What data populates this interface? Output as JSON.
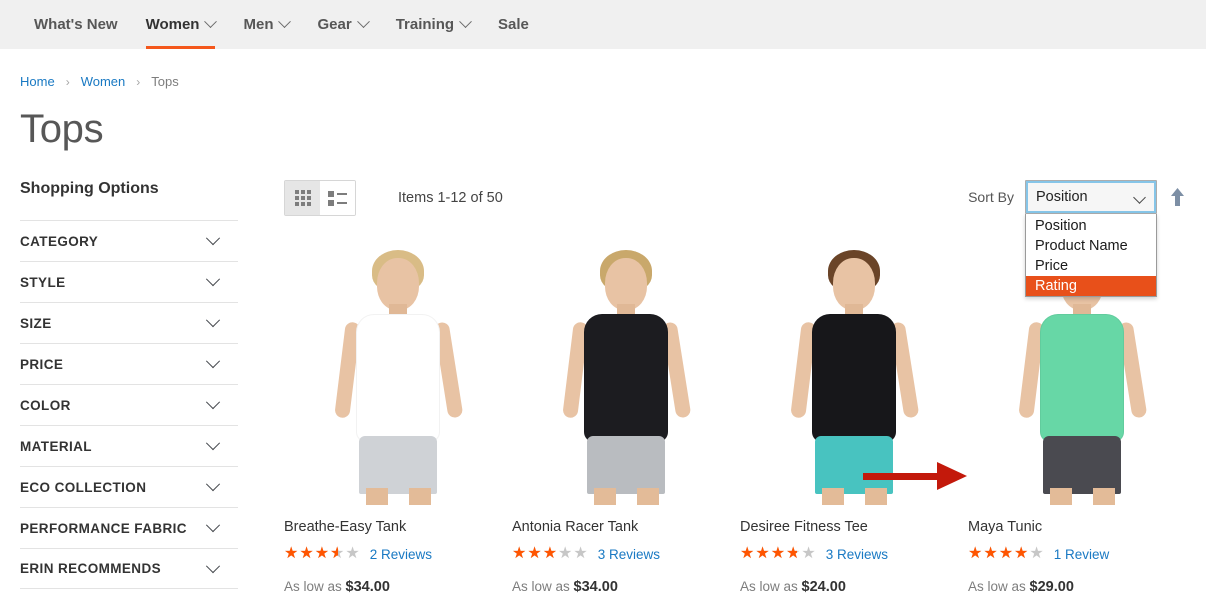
{
  "nav": {
    "items": [
      {
        "label": "What's New",
        "has_caret": false,
        "active": false
      },
      {
        "label": "Women",
        "has_caret": true,
        "active": true
      },
      {
        "label": "Men",
        "has_caret": true,
        "active": false
      },
      {
        "label": "Gear",
        "has_caret": true,
        "active": false
      },
      {
        "label": "Training",
        "has_caret": true,
        "active": false
      },
      {
        "label": "Sale",
        "has_caret": false,
        "active": false
      }
    ]
  },
  "breadcrumb": {
    "home": "Home",
    "sep": "›",
    "women": "Women",
    "current": "Tops"
  },
  "page": {
    "title": "Tops"
  },
  "sidebar": {
    "title": "Shopping Options",
    "filters": [
      {
        "label": "CATEGORY"
      },
      {
        "label": "STYLE"
      },
      {
        "label": "SIZE"
      },
      {
        "label": "PRICE"
      },
      {
        "label": "COLOR"
      },
      {
        "label": "MATERIAL"
      },
      {
        "label": "ECO COLLECTION"
      },
      {
        "label": "PERFORMANCE FABRIC"
      },
      {
        "label": "ERIN RECOMMENDS"
      }
    ]
  },
  "toolbar": {
    "grid_icon": "grid-view-icon",
    "list_icon": "list-view-icon",
    "item_count": "Items 1-12 of 50",
    "sort_label": "Sort By",
    "sort_selected": "Position",
    "sort_options": [
      {
        "label": "Position",
        "highlighted": false
      },
      {
        "label": "Product Name",
        "highlighted": false
      },
      {
        "label": "Price",
        "highlighted": false
      },
      {
        "label": "Rating",
        "highlighted": true
      }
    ],
    "sort_direction_icon": "arrow-up-icon"
  },
  "annotation": {
    "type": "arrow",
    "points_to": "Rating",
    "color": "#c3190b"
  },
  "products": [
    {
      "name": "Breathe-Easy Tank",
      "rating_percent": 70,
      "review_count": "2",
      "review_label": "Reviews",
      "price_prefix": "As low as",
      "price": "$34.00",
      "photo": {
        "hair": "#d9bc86",
        "top": "#ffffff",
        "bottom": "#cfd2d6"
      }
    },
    {
      "name": "Antonia Racer Tank",
      "rating_percent": 60,
      "review_count": "3",
      "review_label": "Reviews",
      "price_prefix": "As low as",
      "price": "$34.00",
      "photo": {
        "hair": "#c9a86b",
        "top": "#1c1c20",
        "bottom": "#b9bcc0"
      }
    },
    {
      "name": "Desiree Fitness Tee",
      "rating_percent": 74,
      "review_count": "3",
      "review_label": "Reviews",
      "price_prefix": "As low as",
      "price": "$24.00",
      "photo": {
        "hair": "#6a4428",
        "top": "#17171a",
        "bottom": "#48c3c0"
      }
    },
    {
      "name": "Maya Tunic",
      "rating_percent": 80,
      "review_count": "1",
      "review_label": "Review",
      "price_prefix": "As low as",
      "price": "$29.00",
      "photo": {
        "hair": "#7a5235",
        "top": "#67d7a6",
        "bottom": "#4a4a50"
      }
    }
  ],
  "colors": {
    "accent": "#ff5501",
    "nav_underline": "#f4571b",
    "link": "#1979c3",
    "highlight": "#e8501a",
    "focus_ring": "#86c5e8"
  },
  "stars_glyphs": {
    "filled": "★★★★★",
    "empty": "★★★★★"
  }
}
